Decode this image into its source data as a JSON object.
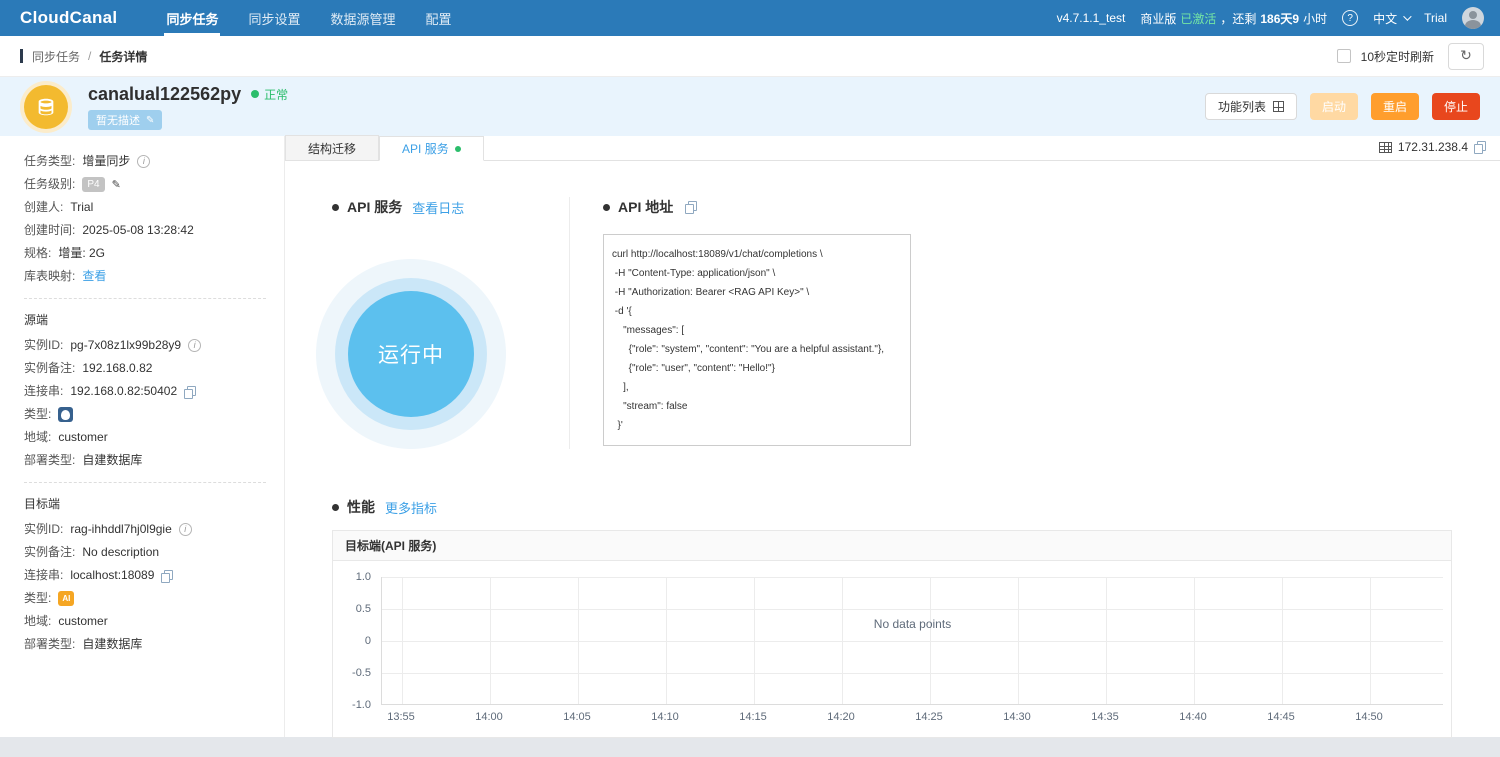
{
  "topbar": {
    "logo": "CloudCanal",
    "nav": [
      {
        "label": "同步任务"
      },
      {
        "label": "同步设置"
      },
      {
        "label": "数据源管理"
      },
      {
        "label": "配置"
      }
    ],
    "version": "v4.7.1.1_test",
    "license": {
      "edition": "商业版",
      "status": "已激活",
      "mid": "，还剩",
      "days": "186天9",
      "unit": "小时"
    },
    "language": "中文",
    "username": "Trial"
  },
  "breadcrumb": {
    "section": "同步任务",
    "separator": "/",
    "current": "任务详情",
    "auto_refresh": "10秒定时刷新"
  },
  "header": {
    "title": "canalual122562py",
    "status": "正常",
    "description": "暂无描述",
    "buttons": {
      "feature_list": "功能列表",
      "start": "启动",
      "restart": "重启",
      "stop": "停止"
    }
  },
  "sidebar": {
    "info": [
      {
        "label": "任务类型:",
        "value": "增量同步"
      },
      {
        "label": "任务级别:",
        "value": "P4"
      },
      {
        "label": "创建人:",
        "value": "Trial"
      },
      {
        "label": "创建时间:",
        "value": "2025-05-08 13:28:42"
      },
      {
        "label": "规格:",
        "value": "增量: 2G"
      },
      {
        "label": "库表映射:",
        "value": "查看"
      }
    ],
    "source": {
      "title": "源端",
      "type_icon": "PostgreSQL",
      "fields": [
        {
          "label": "实例ID:",
          "value": "pg-7x08z1lx99b28y9"
        },
        {
          "label": "实例备注:",
          "value": "192.168.0.82"
        },
        {
          "label": "连接串:",
          "value": "192.168.0.82:50402"
        },
        {
          "label": "类型:",
          "value": ""
        },
        {
          "label": "地域:",
          "value": "customer"
        },
        {
          "label": "部署类型:",
          "value": "自建数据库"
        }
      ]
    },
    "target": {
      "title": "目标端",
      "type_icon": "AI",
      "fields": [
        {
          "label": "实例ID:",
          "value": "rag-ihhddl7hj0l9gie"
        },
        {
          "label": "实例备注:",
          "value": "No description"
        },
        {
          "label": "连接串:",
          "value": "localhost:18089"
        },
        {
          "label": "类型:",
          "value": ""
        },
        {
          "label": "地域:",
          "value": "customer"
        },
        {
          "label": "部署类型:",
          "value": "自建数据库"
        }
      ]
    }
  },
  "main": {
    "tabs": [
      {
        "label": "结构迁移"
      },
      {
        "label": "API 服务"
      }
    ],
    "server_ip": "172.31.238.4",
    "api_service": {
      "title": "API 服务",
      "log_link": "查看日志",
      "status_text": "运行中"
    },
    "api_address": {
      "title": "API 地址",
      "code_lines": [
        "curl http://localhost:18089/v1/chat/completions \\",
        " -H \"Content-Type: application/json\" \\",
        " -H \"Authorization: Bearer <RAG API Key>\" \\",
        " -d '{",
        "    \"messages\": [",
        "      {\"role\": \"system\", \"content\": \"You are a helpful assistant.\"},",
        "      {\"role\": \"user\", \"content\": \"Hello!\"}",
        "    ],",
        "    \"stream\": false",
        "  }'"
      ]
    },
    "performance": {
      "title": "性能",
      "more_link": "更多指标"
    }
  },
  "chart_data": {
    "type": "line",
    "title": "目标端(API 服务)",
    "x_labels": [
      "13:55",
      "14:00",
      "14:05",
      "14:10",
      "14:15",
      "14:20",
      "14:25",
      "14:30",
      "14:35",
      "14:40",
      "14:45",
      "14:50"
    ],
    "y_ticks": [
      "1.0",
      "0.5",
      "0",
      "-0.5",
      "-1.0"
    ],
    "ylim": [
      -1.0,
      1.0
    ],
    "series": [],
    "empty_message": "No data points",
    "grid": true,
    "legend": "none"
  },
  "colors": {
    "topbar_bg": "#2b7ab8",
    "link_blue": "#3ca0e6",
    "status_green": "#2bbd6b",
    "restart_orange": "#ff9e2d",
    "stop_red": "#e8471d",
    "running_circle_blue": "#5cc0ee",
    "task_icon_yellow": "#f3ba2f"
  }
}
